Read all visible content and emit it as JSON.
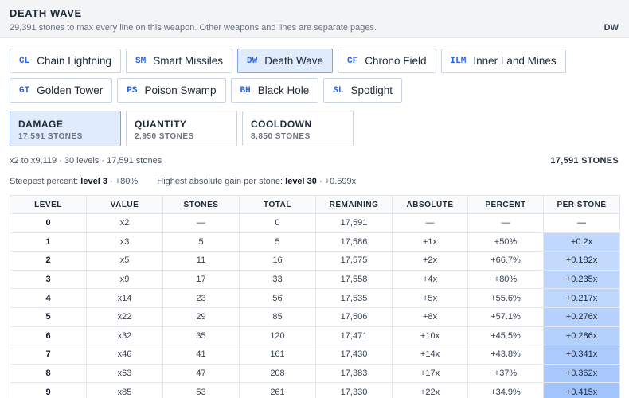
{
  "header": {
    "title": "DEATH WAVE",
    "subtitle": "29,391 stones to max every line on this weapon. Other weapons and lines are separate pages.",
    "badge": "DW"
  },
  "weapons": [
    {
      "code": "CL",
      "name": "Chain Lightning",
      "active": false
    },
    {
      "code": "SM",
      "name": "Smart Missiles",
      "active": false
    },
    {
      "code": "DW",
      "name": "Death Wave",
      "active": true
    },
    {
      "code": "CF",
      "name": "Chrono Field",
      "active": false
    },
    {
      "code": "ILM",
      "name": "Inner Land Mines",
      "active": false
    },
    {
      "code": "GT",
      "name": "Golden Tower",
      "active": false
    },
    {
      "code": "PS",
      "name": "Poison Swamp",
      "active": false
    },
    {
      "code": "BH",
      "name": "Black Hole",
      "active": false
    },
    {
      "code": "SL",
      "name": "Spotlight",
      "active": false
    }
  ],
  "stats": [
    {
      "name": "DAMAGE",
      "cost": "17,591 STONES",
      "active": true
    },
    {
      "name": "QUANTITY",
      "cost": "2,950 STONES",
      "active": false
    },
    {
      "name": "COOLDOWN",
      "cost": "8,850 STONES",
      "active": false
    }
  ],
  "summary": {
    "text": "x2 to x9,119 · 30 levels · 17,591 stones",
    "total": "17,591 STONES"
  },
  "notes": {
    "steepest_label": "Steepest percent:",
    "steepest_value": "level 3",
    "steepest_extra": "· +80%",
    "highest_label": "Highest absolute gain per stone:",
    "highest_value": "level 30",
    "highest_extra": "· +0.599x"
  },
  "table": {
    "columns": [
      "LEVEL",
      "VALUE",
      "STONES",
      "TOTAL",
      "REMAINING",
      "ABSOLUTE",
      "PERCENT",
      "PER STONE"
    ],
    "rows": [
      {
        "level": "0",
        "value": "x2",
        "stones": "—",
        "total": "0",
        "remaining": "17,591",
        "absolute": "—",
        "percent": "—",
        "per_stone": "—",
        "intensity": 0
      },
      {
        "level": "1",
        "value": "x3",
        "stones": "5",
        "total": "5",
        "remaining": "17,586",
        "absolute": "+1x",
        "percent": "+50%",
        "per_stone": "+0.2x",
        "intensity": 0.2
      },
      {
        "level": "2",
        "value": "x5",
        "stones": "11",
        "total": "16",
        "remaining": "17,575",
        "absolute": "+2x",
        "percent": "+66.7%",
        "per_stone": "+0.182x",
        "intensity": 0.182
      },
      {
        "level": "3",
        "value": "x9",
        "stones": "17",
        "total": "33",
        "remaining": "17,558",
        "absolute": "+4x",
        "percent": "+80%",
        "per_stone": "+0.235x",
        "intensity": 0.235
      },
      {
        "level": "4",
        "value": "x14",
        "stones": "23",
        "total": "56",
        "remaining": "17,535",
        "absolute": "+5x",
        "percent": "+55.6%",
        "per_stone": "+0.217x",
        "intensity": 0.217
      },
      {
        "level": "5",
        "value": "x22",
        "stones": "29",
        "total": "85",
        "remaining": "17,506",
        "absolute": "+8x",
        "percent": "+57.1%",
        "per_stone": "+0.276x",
        "intensity": 0.276
      },
      {
        "level": "6",
        "value": "x32",
        "stones": "35",
        "total": "120",
        "remaining": "17,471",
        "absolute": "+10x",
        "percent": "+45.5%",
        "per_stone": "+0.286x",
        "intensity": 0.286
      },
      {
        "level": "7",
        "value": "x46",
        "stones": "41",
        "total": "161",
        "remaining": "17,430",
        "absolute": "+14x",
        "percent": "+43.8%",
        "per_stone": "+0.341x",
        "intensity": 0.341
      },
      {
        "level": "8",
        "value": "x63",
        "stones": "47",
        "total": "208",
        "remaining": "17,383",
        "absolute": "+17x",
        "percent": "+37%",
        "per_stone": "+0.362x",
        "intensity": 0.362
      },
      {
        "level": "9",
        "value": "x85",
        "stones": "53",
        "total": "261",
        "remaining": "17,330",
        "absolute": "+22x",
        "percent": "+34.9%",
        "per_stone": "+0.415x",
        "intensity": 0.415
      }
    ]
  }
}
